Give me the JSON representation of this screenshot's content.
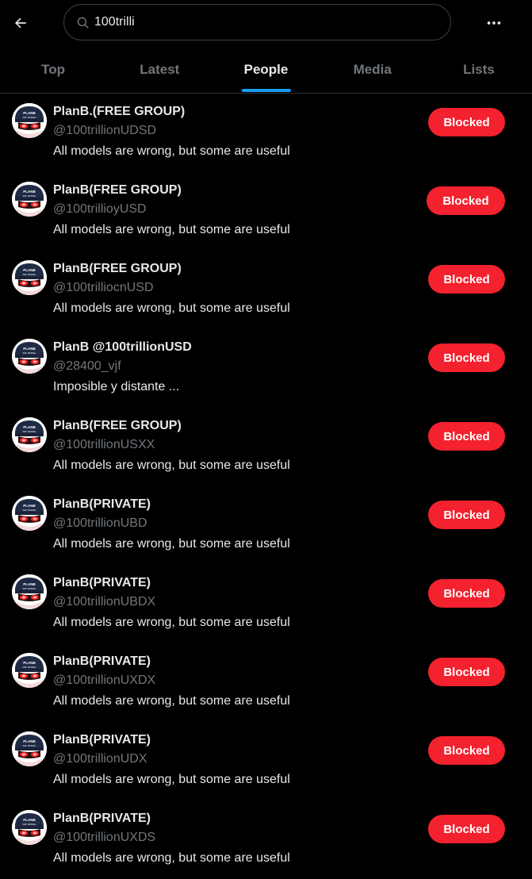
{
  "search": {
    "query": "100trilli"
  },
  "tabs": [
    {
      "label": "Top",
      "active": false
    },
    {
      "label": "Latest",
      "active": false
    },
    {
      "label": "People",
      "active": true
    },
    {
      "label": "Media",
      "active": false
    },
    {
      "label": "Lists",
      "active": false
    }
  ],
  "results": [
    {
      "name": "PlanB.(FREE GROUP)",
      "handle": "@100trillionUDSD",
      "bio": "All models are wrong, but some are useful",
      "button": "Blocked"
    },
    {
      "name": "PlanB(FREE GROUP)",
      "handle": "@100trillioyUSD",
      "bio": "All models are wrong, but some are useful",
      "button": "Blocked"
    },
    {
      "name": "PlanB(FREE GROUP)",
      "handle": "@100trilliocnUSD",
      "bio": "All models are wrong, but some are useful",
      "button": "Blocked"
    },
    {
      "name": "PlanB @100trillionUSD",
      "handle": "@28400_vjf",
      "bio": "Imposible y distante ...",
      "button": "Blocked"
    },
    {
      "name": "PlanB(FREE GROUP)",
      "handle": "@100trillionUSXX",
      "bio": "All models are wrong, but some are useful",
      "button": "Blocked"
    },
    {
      "name": "PlanB(PRIVATE)",
      "handle": "@100trillionUBD",
      "bio": "All models are wrong, but some are useful",
      "button": "Blocked"
    },
    {
      "name": "PlanB(PRIVATE)",
      "handle": "@100trillionUBDX",
      "bio": "All models are wrong, but some are useful",
      "button": "Blocked"
    },
    {
      "name": "PlanB(PRIVATE)",
      "handle": "@100trillionUXDX",
      "bio": "All models are wrong, but some are useful",
      "button": "Blocked"
    },
    {
      "name": "PlanB(PRIVATE)",
      "handle": "@100trillionUDX",
      "bio": "All models are wrong, but some are useful",
      "button": "Blocked"
    },
    {
      "name": "PlanB(PRIVATE)",
      "handle": "@100trillionUXDS",
      "bio": "All models are wrong, but some are useful",
      "button": "Blocked"
    }
  ],
  "colors": {
    "accent": "#1d9bf0",
    "blocked": "#f4212e",
    "background": "#000000",
    "muted_text": "#71767b"
  },
  "icons": {
    "back": "arrow-left-icon",
    "search": "search-icon",
    "more": "more-horizontal-icon",
    "avatar": "planb-avatar"
  }
}
